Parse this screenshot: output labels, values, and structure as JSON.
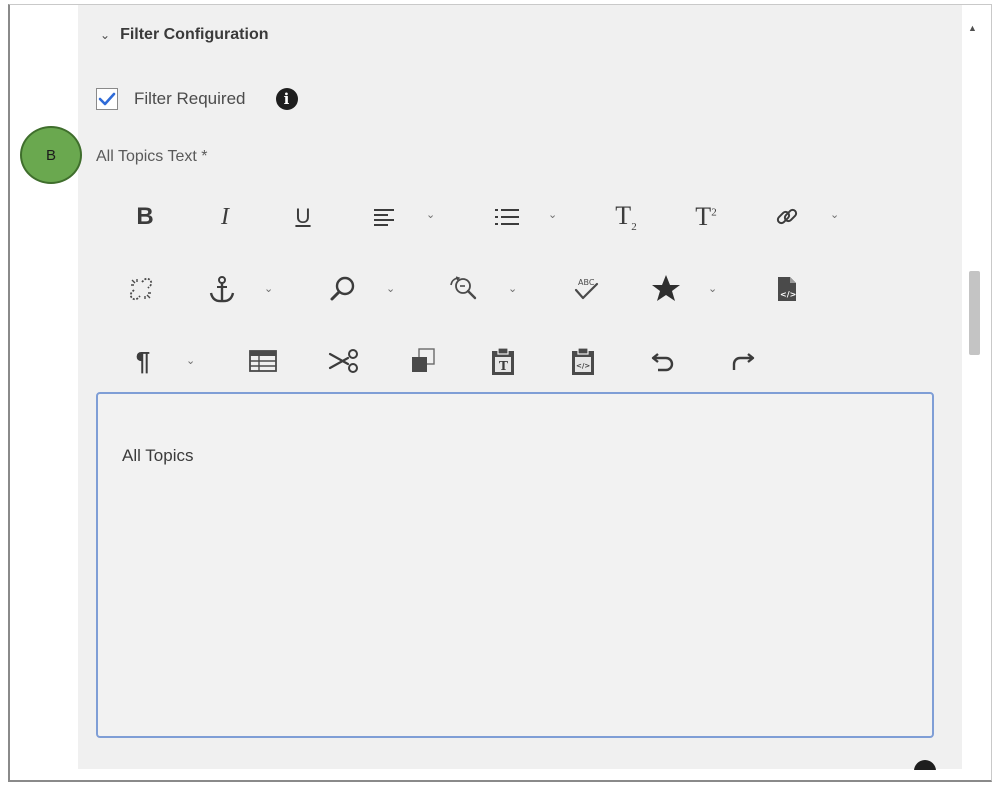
{
  "section": {
    "chevron_icon": "chevron-down-icon",
    "title": "Filter Configuration"
  },
  "filter_required": {
    "label": "Filter Required",
    "checked": true,
    "info_icon": "info-icon",
    "info_glyph": "i"
  },
  "annotation_badge": "B",
  "all_topics_text": {
    "label": "All Topics Text *",
    "value": "All Topics"
  },
  "toolbar": {
    "row1": [
      {
        "name": "bold-icon",
        "glyph": "B"
      },
      {
        "name": "italic-icon",
        "glyph": "I"
      },
      {
        "name": "underline-icon",
        "glyph": "U"
      },
      {
        "name": "align-icon",
        "dropdown": true
      },
      {
        "name": "list-icon",
        "dropdown": true
      },
      {
        "name": "subscript-icon",
        "glyph": "T₂"
      },
      {
        "name": "superscript-icon",
        "glyph": "T²"
      },
      {
        "name": "link-icon",
        "dropdown": true
      }
    ],
    "row2": [
      {
        "name": "unlink-icon"
      },
      {
        "name": "anchor-icon",
        "dropdown": true
      },
      {
        "name": "find-icon",
        "dropdown": true
      },
      {
        "name": "find-replace-icon",
        "dropdown": true
      },
      {
        "name": "spellcheck-icon"
      },
      {
        "name": "special-characters-icon",
        "dropdown": true
      },
      {
        "name": "source-edit-icon"
      }
    ],
    "row3": [
      {
        "name": "paragraph-format-icon",
        "glyph": "¶",
        "dropdown": true
      },
      {
        "name": "table-icon"
      },
      {
        "name": "cut-icon"
      },
      {
        "name": "copy-icon"
      },
      {
        "name": "paste-text-icon"
      },
      {
        "name": "paste-html-icon"
      },
      {
        "name": "undo-icon"
      },
      {
        "name": "redo-icon"
      }
    ]
  },
  "scrollbar": {
    "arrow_icon": "triangle-up-icon"
  },
  "colors": {
    "panel_bg": "#f0f0f0",
    "checkbox_check": "#2f6bd8",
    "editor_border": "#7f9ed6",
    "badge_green": "#6aa84f"
  }
}
